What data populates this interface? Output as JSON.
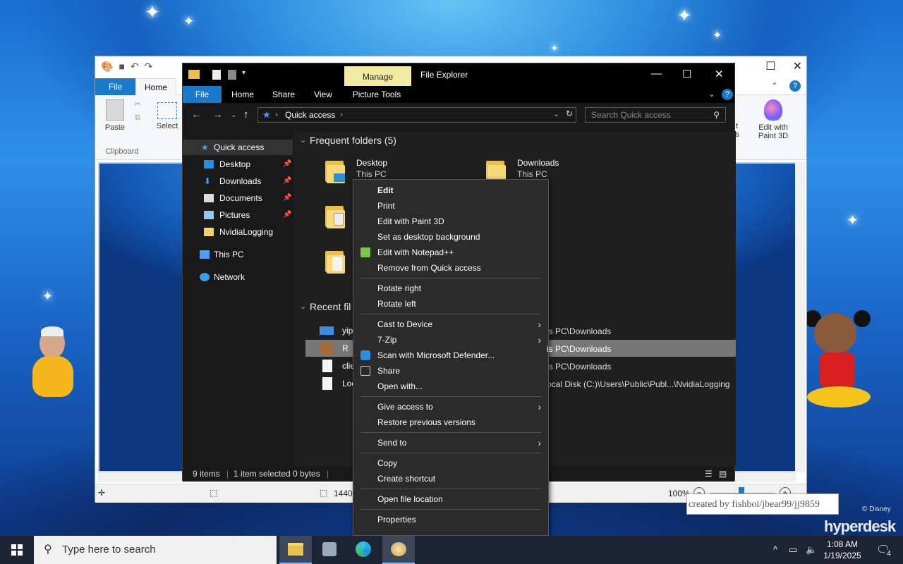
{
  "colors": {
    "accent": "#1979ca",
    "manage_tab": "#f2eca0",
    "explorer_bg": "#191919",
    "taskbar": "#1c2333"
  },
  "paint": {
    "tabs": {
      "file": "File",
      "home": "Home"
    },
    "ribbon": {
      "paste": "Paste",
      "select": "Select",
      "clipboard_group": "Clipboard",
      "edit_with_paint3d_line1": "Edit with",
      "edit_with_paint3d_line2": "Paint 3D",
      "cut_line1": "t",
      "cut_line2": "rs"
    },
    "status": {
      "dimensions": "1440",
      "zoom": "100%"
    }
  },
  "explorer": {
    "title": "File Explorer",
    "manage_tab": "Manage",
    "tabs": [
      "File",
      "Home",
      "Share",
      "View",
      "Picture Tools"
    ],
    "address": "Quick access",
    "search_placeholder": "Search Quick access",
    "nav": [
      {
        "label": "Quick access",
        "icon": "star-icon"
      },
      {
        "label": "Desktop",
        "icon": "desktop-icon",
        "pinned": true
      },
      {
        "label": "Downloads",
        "icon": "download-icon",
        "pinned": true
      },
      {
        "label": "Documents",
        "icon": "documents-icon",
        "pinned": true
      },
      {
        "label": "Pictures",
        "icon": "pictures-icon",
        "pinned": true
      },
      {
        "label": "NvidiaLogging",
        "icon": "folder-icon"
      },
      {
        "label": "This PC",
        "icon": "computer-icon"
      },
      {
        "label": "Network",
        "icon": "network-icon"
      }
    ],
    "frequent_header": "Frequent folders (5)",
    "frequent": [
      {
        "name": "Desktop",
        "sub": "This PC"
      },
      {
        "name": "Downloads",
        "sub": "This PC"
      }
    ],
    "recent_header": "Recent fil",
    "recent": [
      {
        "name": "yip",
        "location": "is PC\\Downloads"
      },
      {
        "name": "R",
        "location": "is PC\\Downloads"
      },
      {
        "name": "clie",
        "location": "is PC\\Downloads"
      },
      {
        "name": "Loc",
        "location": "ocal Disk (C:)\\Users\\Public\\Publ...\\NvidiaLogging"
      }
    ],
    "status": {
      "items": "9 items",
      "selected": "1 item selected  0 bytes"
    }
  },
  "context_menu": {
    "items": [
      {
        "label": "Edit",
        "bold": true
      },
      {
        "label": "Print"
      },
      {
        "label": "Edit with Paint 3D"
      },
      {
        "label": "Set as desktop background"
      },
      {
        "label": "Edit with Notepad++",
        "icon": "notepadpp-icon"
      },
      {
        "label": "Remove from Quick access"
      },
      {
        "label": "Rotate right"
      },
      {
        "label": "Rotate left"
      },
      {
        "label": "Cast to Device",
        "submenu": true
      },
      {
        "label": "7-Zip",
        "submenu": true
      },
      {
        "label": "Scan with Microsoft Defender...",
        "icon": "defender-icon"
      },
      {
        "label": "Share",
        "icon": "share-icon"
      },
      {
        "label": "Open with..."
      },
      {
        "label": "Give access to",
        "submenu": true
      },
      {
        "label": "Restore previous versions"
      },
      {
        "label": "Send to",
        "submenu": true
      },
      {
        "label": "Copy"
      },
      {
        "label": "Create shortcut"
      },
      {
        "label": "Open file location"
      },
      {
        "label": "Properties"
      }
    ]
  },
  "desktop": {
    "credit": "created by fishboi/jbear99/jj9859",
    "disney": "© Disney",
    "brand": "hyperdesk"
  },
  "taskbar": {
    "search_placeholder": "Type here to search",
    "time": "1:08 AM",
    "date": "1/19/2025",
    "notifications": "4"
  }
}
